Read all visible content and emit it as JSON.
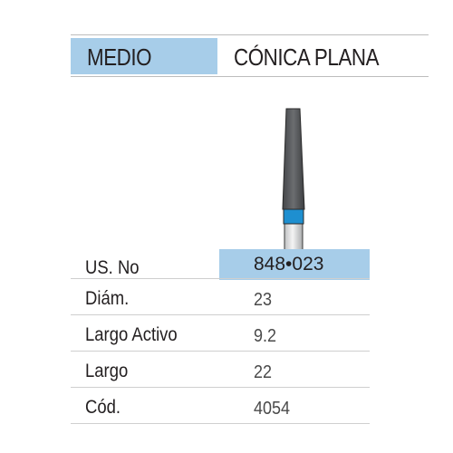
{
  "header": {
    "grade": "MEDIO",
    "shape": "CÓNICA PLANA"
  },
  "colors": {
    "band": "#a7cde9",
    "bur_body": "#5d5f62",
    "bur_ring": "#1e8fd0"
  },
  "specs": {
    "us_no": {
      "label": "US. No",
      "value": "848•023"
    },
    "rows": [
      {
        "label": "Diám.",
        "value": "23"
      },
      {
        "label": "Largo Activo",
        "value": "9.2"
      },
      {
        "label": "Largo",
        "value": "22"
      },
      {
        "label": "Cód.",
        "value": "4054"
      }
    ]
  }
}
